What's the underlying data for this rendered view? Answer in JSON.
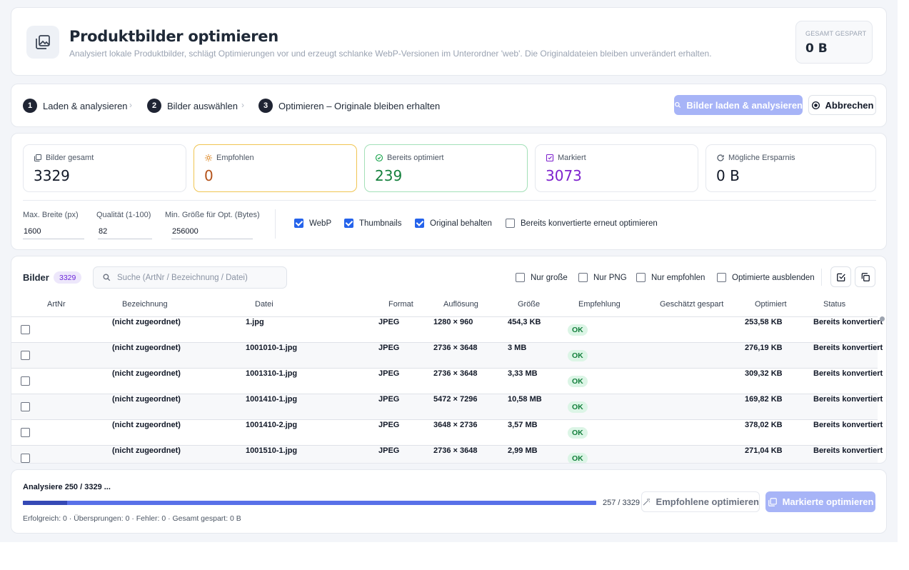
{
  "header": {
    "title": "Produktbilder optimieren",
    "subtitle": "Analysiert lokale Produktbilder, schlägt Optimierungen vor und erzeugt schlanke WebP-Versionen im Unterordner 'web'. Die Originaldateien bleiben unverändert erhalten.",
    "saved_label": "GESAMT GESPART",
    "saved_value": "0 B",
    "icon": "images-icon"
  },
  "steps": [
    {
      "num": "1",
      "label": "Laden & analysieren"
    },
    {
      "num": "2",
      "label": "Bilder auswählen"
    },
    {
      "num": "3",
      "label": "Optimieren – Originale bleiben erhalten"
    }
  ],
  "actions": {
    "load_label": "Bilder laden & analysieren",
    "cancel_label": "Abbrechen"
  },
  "stats": [
    {
      "label": "Bilder gesamt",
      "value": "3329",
      "icon": "images-icon",
      "color": "#111827"
    },
    {
      "label": "Empfohlen",
      "value": "0",
      "icon": "lightbulb-icon",
      "color": "#b4531b"
    },
    {
      "label": "Bereits optimiert",
      "value": "239",
      "icon": "check-circle-icon",
      "color": "#15803d"
    },
    {
      "label": "Markiert",
      "value": "3073",
      "icon": "check-square-icon",
      "color": "#7e22ce"
    },
    {
      "label": "Mögliche Ersparnis",
      "value": "0 B",
      "icon": "refresh-icon",
      "color": "#111827"
    }
  ],
  "settings": {
    "max_width_label": "Max. Breite (px)",
    "max_width_value": "1600",
    "quality_label": "Qualität (1-100)",
    "quality_value": "82",
    "min_size_label": "Min. Größe für Opt. (Bytes)",
    "min_size_value": "256000",
    "webp_label": "WebP",
    "webp_checked": true,
    "thumbnails_label": "Thumbnails",
    "thumbnails_checked": true,
    "keep_original_label": "Original behalten",
    "keep_original_checked": true,
    "reoptimize_label": "Bereits konvertierte erneut optimieren",
    "reoptimize_checked": false
  },
  "table": {
    "title": "Bilder",
    "count": "3329",
    "search_placeholder": "Suche (ArtNr / Bezeichnung / Datei)",
    "filters": {
      "large_only": "Nur große",
      "png_only": "Nur PNG",
      "recommended_only": "Nur empfohlen",
      "hide_optimized": "Optimierte ausblenden"
    },
    "columns": [
      "ArtNr",
      "Bezeichnung",
      "Datei",
      "Format",
      "Auflösung",
      "Größe",
      "Empfehlung",
      "Geschätzt gespart",
      "Optimiert",
      "Status"
    ],
    "rows": [
      {
        "artnr": "",
        "name": "(nicht zugeordnet)",
        "file": "1.jpg",
        "format": "JPEG",
        "resolution": "1280 × 960",
        "size": "454,3 KB",
        "recommendation": "OK",
        "estimated": "",
        "optimized": "253,58 KB",
        "status": "Bereits konvertiert"
      },
      {
        "artnr": "",
        "name": "(nicht zugeordnet)",
        "file": "1001010-1.jpg",
        "format": "JPEG",
        "resolution": "2736 × 3648",
        "size": "3 MB",
        "recommendation": "OK",
        "estimated": "",
        "optimized": "276,19 KB",
        "status": "Bereits konvertiert"
      },
      {
        "artnr": "",
        "name": "(nicht zugeordnet)",
        "file": "1001310-1.jpg",
        "format": "JPEG",
        "resolution": "2736 × 3648",
        "size": "3,33 MB",
        "recommendation": "OK",
        "estimated": "",
        "optimized": "309,32 KB",
        "status": "Bereits konvertiert"
      },
      {
        "artnr": "",
        "name": "(nicht zugeordnet)",
        "file": "1001410-1.jpg",
        "format": "JPEG",
        "resolution": "5472 × 7296",
        "size": "10,58 MB",
        "recommendation": "OK",
        "estimated": "",
        "optimized": "169,82 KB",
        "status": "Bereits konvertiert"
      },
      {
        "artnr": "",
        "name": "(nicht zugeordnet)",
        "file": "1001410-2.jpg",
        "format": "JPEG",
        "resolution": "3648 × 2736",
        "size": "3,57 MB",
        "recommendation": "OK",
        "estimated": "",
        "optimized": "378,02 KB",
        "status": "Bereits konvertiert"
      },
      {
        "artnr": "",
        "name": "(nicht zugeordnet)",
        "file": "1001510-1.jpg",
        "format": "JPEG",
        "resolution": "2736 × 3648",
        "size": "2,99 MB",
        "recommendation": "OK",
        "estimated": "",
        "optimized": "271,04 KB",
        "status": "Bereits konvertiert"
      }
    ]
  },
  "footer": {
    "status": "Analysiere 250 / 3329 ...",
    "progress_fraction": 0.077,
    "progress_text": "257 / 3329",
    "stats_text": "Erfolgreich: 0  ·  Übersprungen: 0  ·  Fehler: 0  ·  Gesamt gespart: 0 B",
    "optimize_recommended_label": "Empfohlene optimieren",
    "optimize_marked_label": "Markierte optimieren"
  },
  "colors": {
    "accent": "#4f63e8",
    "accent_disabled": "#a7b4f7",
    "ok_bg": "#dcf5e6",
    "ok_fg": "#15803d",
    "badge_bg": "#ede7fb",
    "badge_fg": "#6d28d9"
  }
}
